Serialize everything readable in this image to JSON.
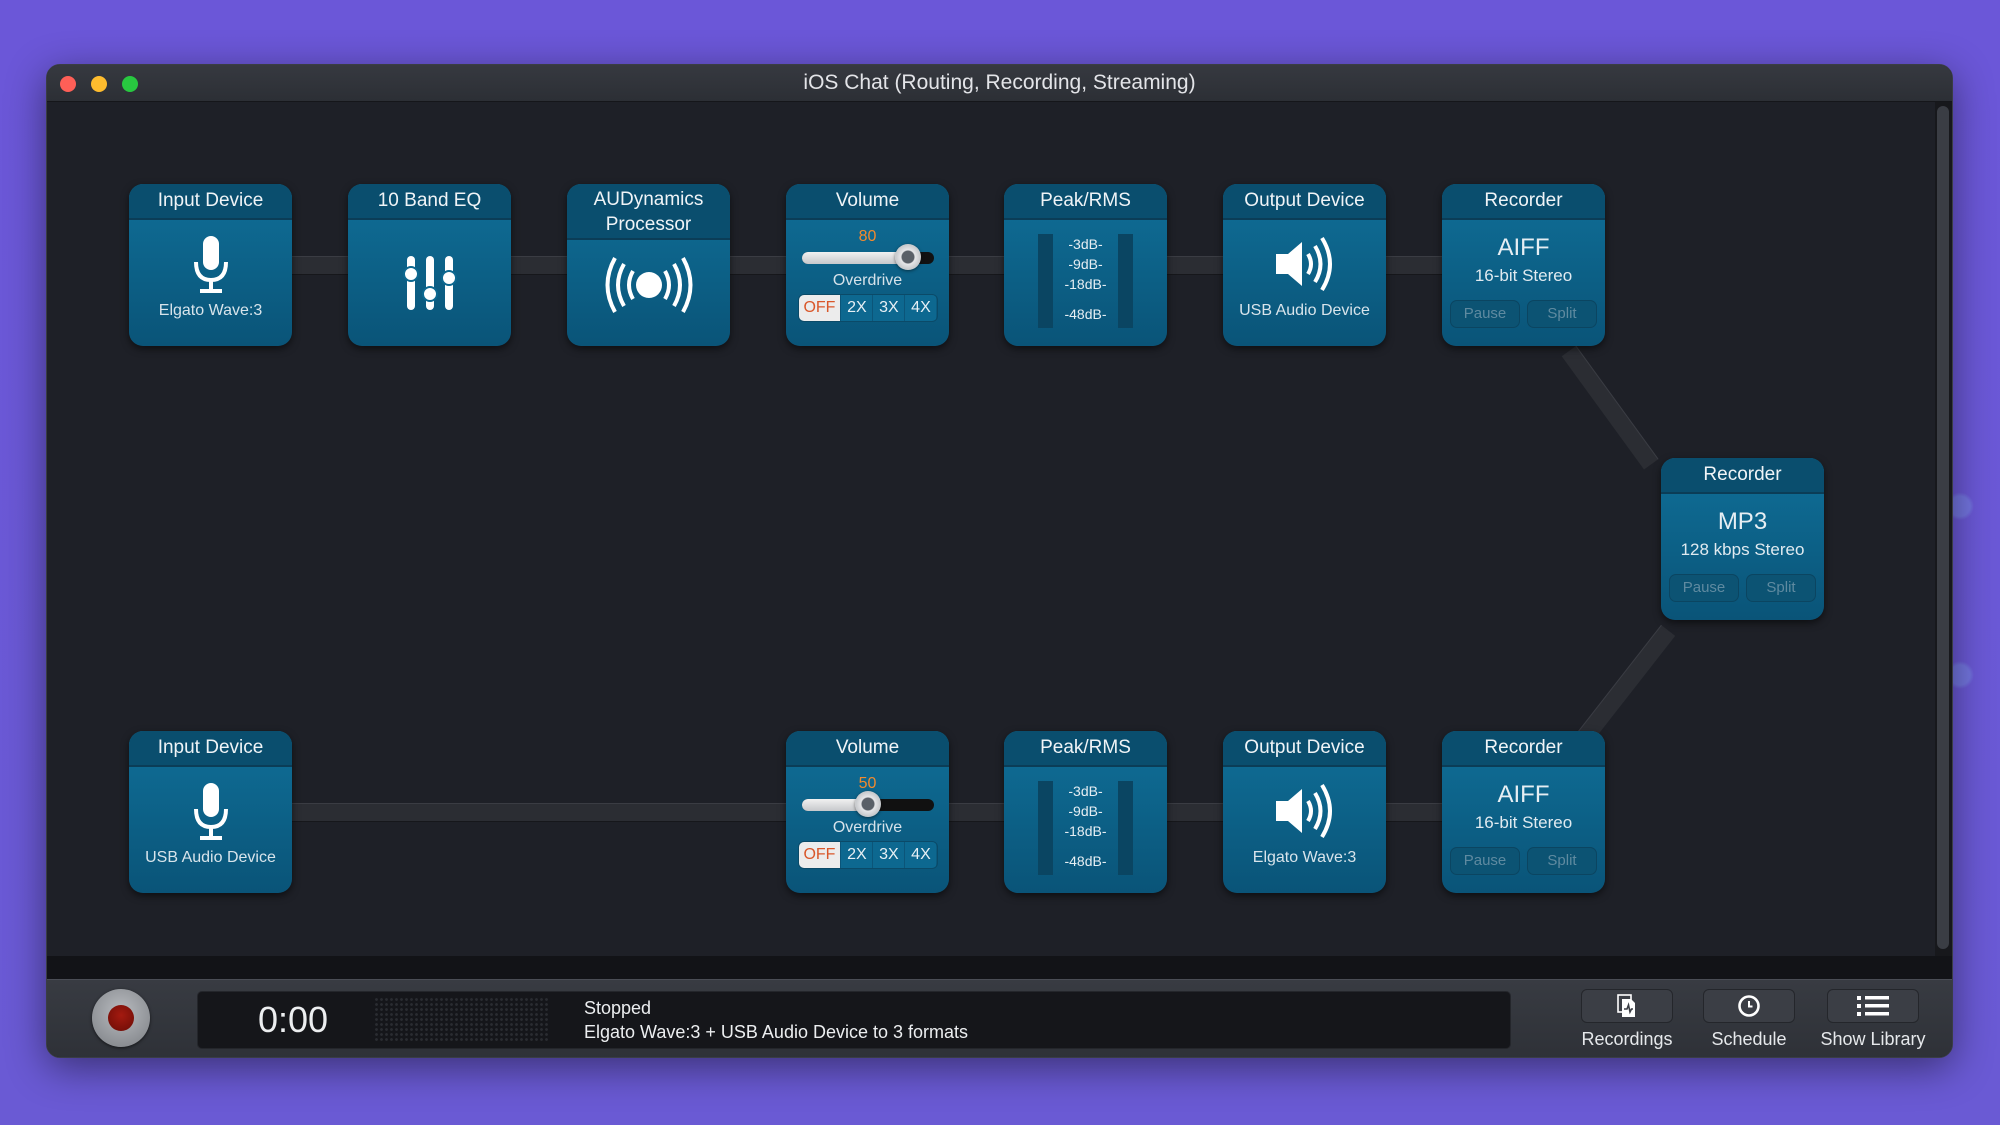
{
  "window": {
    "title": "iOS Chat (Routing, Recording, Streaming)"
  },
  "blocks": {
    "input_top": {
      "title": "Input Device",
      "device": "Elgato Wave:3",
      "icon": "microphone-icon"
    },
    "eq": {
      "title": "10 Band EQ",
      "icon": "equalizer-sliders-icon"
    },
    "dynamics": {
      "title": "AUDynamics Processor",
      "icon": "broadcast-icon"
    },
    "volume_top": {
      "title": "Volume",
      "value": "80",
      "level": 0.8,
      "overdrive_label": "Overdrive",
      "overdrive_options": [
        "OFF",
        "2X",
        "3X",
        "4X"
      ],
      "overdrive_selected": "OFF"
    },
    "meter_top": {
      "title": "Peak/RMS",
      "scale": [
        "-3dB-",
        "-9dB-",
        "-18dB-",
        "-48dB-"
      ]
    },
    "output_top": {
      "title": "Output Device",
      "device": "USB Audio Device",
      "icon": "speaker-icon"
    },
    "recorder_top": {
      "title": "Recorder",
      "format": "AIFF",
      "detail": "16-bit Stereo",
      "pause_label": "Pause",
      "split_label": "Split"
    },
    "recorder_mp3": {
      "title": "Recorder",
      "format": "MP3",
      "detail": "128 kbps Stereo",
      "pause_label": "Pause",
      "split_label": "Split"
    },
    "input_bottom": {
      "title": "Input Device",
      "device": "USB Audio Device",
      "icon": "microphone-icon"
    },
    "volume_bottom": {
      "title": "Volume",
      "value": "50",
      "level": 0.5,
      "overdrive_label": "Overdrive",
      "overdrive_options": [
        "OFF",
        "2X",
        "3X",
        "4X"
      ],
      "overdrive_selected": "OFF"
    },
    "meter_bottom": {
      "title": "Peak/RMS",
      "scale": [
        "-3dB-",
        "-9dB-",
        "-18dB-",
        "-48dB-"
      ]
    },
    "output_bottom": {
      "title": "Output Device",
      "device": "Elgato Wave:3",
      "icon": "speaker-icon"
    },
    "recorder_bottom": {
      "title": "Recorder",
      "format": "AIFF",
      "detail": "16-bit Stereo",
      "pause_label": "Pause",
      "split_label": "Split"
    }
  },
  "bottombar": {
    "timer": "0:00",
    "status": "Stopped",
    "summary": "Elgato Wave:3 + USB Audio Device to 3 formats",
    "buttons": [
      {
        "label": "Recordings",
        "icon": "recordings-file-icon"
      },
      {
        "label": "Schedule",
        "icon": "clock-icon"
      },
      {
        "label": "Show Library",
        "icon": "list-icon"
      }
    ]
  },
  "colors": {
    "block": "#0f6f98",
    "accent_value": "#f28a2e",
    "overdrive_off": "#d9572a",
    "record": "#a41a10"
  }
}
